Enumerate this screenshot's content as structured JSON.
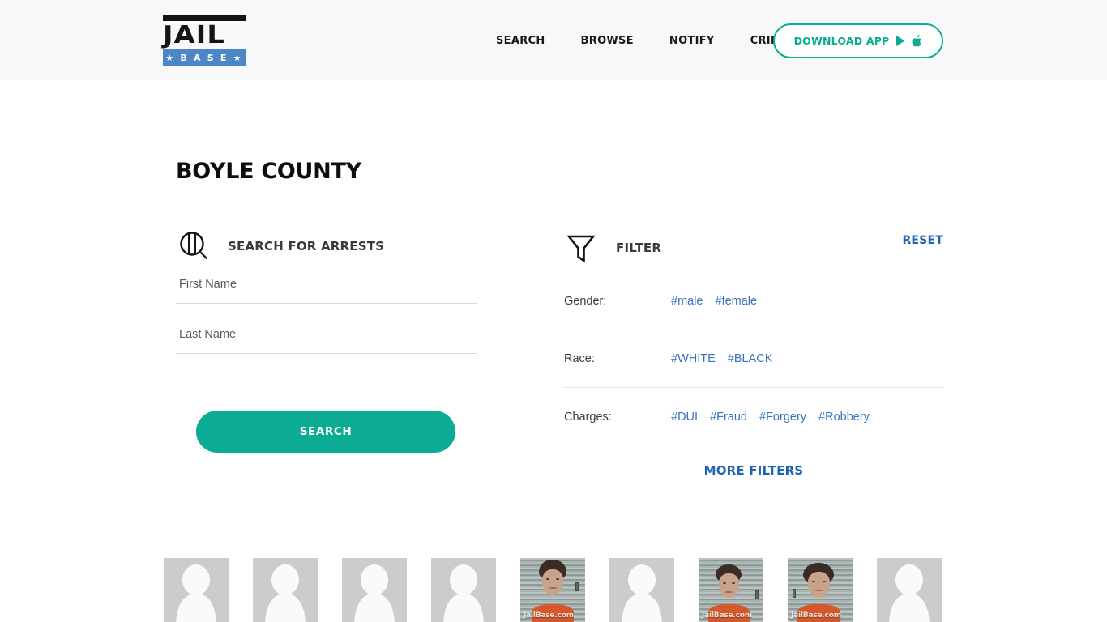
{
  "header": {
    "logo": {
      "primary_text": "JAIL",
      "secondary_text": "★ B A S E ★",
      "blue": "#4d86c4",
      "black": "#141414"
    },
    "nav": [
      {
        "label": "SEARCH",
        "name": "search"
      },
      {
        "label": "BROWSE",
        "name": "browse"
      },
      {
        "label": "NOTIFY",
        "name": "notify"
      },
      {
        "label": "CRIME STATS",
        "name": "crime-stats"
      }
    ],
    "download_button": {
      "label": "DOWNLOAD APP",
      "icons": [
        "google-play-icon",
        "apple-icon"
      ],
      "accent": "#0cab93"
    },
    "background": "#f8f8f9"
  },
  "page": {
    "title": "BOYLE COUNTY"
  },
  "search": {
    "icon": "magnifier-jailbars-icon",
    "heading": "SEARCH FOR ARRESTS",
    "first_name": {
      "value": "",
      "placeholder": "First Name"
    },
    "last_name": {
      "value": "",
      "placeholder": "Last Name"
    },
    "submit_label": "SEARCH",
    "submit_color": "#0cab93"
  },
  "filter": {
    "icon": "funnel-icon",
    "heading": "FILTER",
    "reset_label": "RESET",
    "more_filters_label": "MORE FILTERS",
    "link_color": "#3b72bd",
    "rows": [
      {
        "label": "Gender:",
        "tags": [
          "#male",
          "#female"
        ]
      },
      {
        "label": "Race:",
        "tags": [
          "#WHITE",
          "#BLACK"
        ]
      },
      {
        "label": "Charges:",
        "tags": [
          "#DUI",
          "#Fraud",
          "#Forgery",
          "#Robbery"
        ]
      }
    ]
  },
  "thumbnails": {
    "watermark": "JailBase.com",
    "items": [
      {
        "type": "placeholder"
      },
      {
        "type": "placeholder"
      },
      {
        "type": "placeholder"
      },
      {
        "type": "placeholder"
      },
      {
        "type": "photo"
      },
      {
        "type": "placeholder"
      },
      {
        "type": "photo"
      },
      {
        "type": "photo"
      },
      {
        "type": "placeholder"
      }
    ]
  }
}
